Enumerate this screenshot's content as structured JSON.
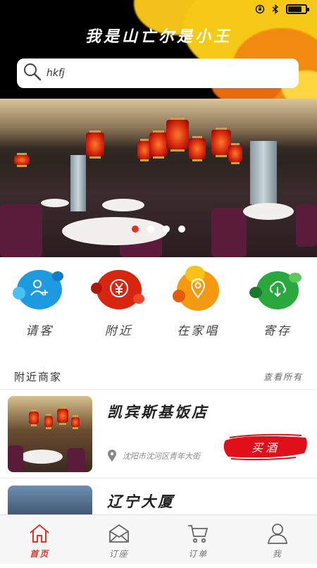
{
  "header": {
    "title": "我是山亡尔是小王",
    "search": {
      "value": "hkfj",
      "placeholder": ""
    }
  },
  "status_bar": {
    "battery_level": 0.8
  },
  "banner": {
    "slide_count": 4,
    "active_slide": 1
  },
  "categories": [
    {
      "label": "请客",
      "icon": "add-user-icon",
      "color": "#1e9be0"
    },
    {
      "label": "附近",
      "icon": "yen-icon",
      "color": "#d8250f"
    },
    {
      "label": "在家唱",
      "icon": "location-pin-icon",
      "color": "#f39a12"
    },
    {
      "label": "寄存",
      "icon": "cloud-download-icon",
      "color": "#2aa83e"
    }
  ],
  "nearby": {
    "title": "附近商家",
    "more_label": "查看所有",
    "merchants": [
      {
        "name": "凯宾斯基饭店",
        "address": "沈阳市沈河区青年大街",
        "action_label": "买酒"
      },
      {
        "name": "辽宁大厦",
        "address": "",
        "action_label": ""
      }
    ]
  },
  "tabbar": {
    "items": [
      {
        "label": "首页",
        "icon": "home-icon",
        "active": true
      },
      {
        "label": "订座",
        "icon": "envelope-icon",
        "active": false
      },
      {
        "label": "订单",
        "icon": "cart-icon",
        "active": false
      },
      {
        "label": "我",
        "icon": "user-icon",
        "active": false
      }
    ]
  },
  "colors": {
    "accent": "#e0322c",
    "header_bg": "#000000",
    "splash_yellow": "#f3c21a"
  }
}
